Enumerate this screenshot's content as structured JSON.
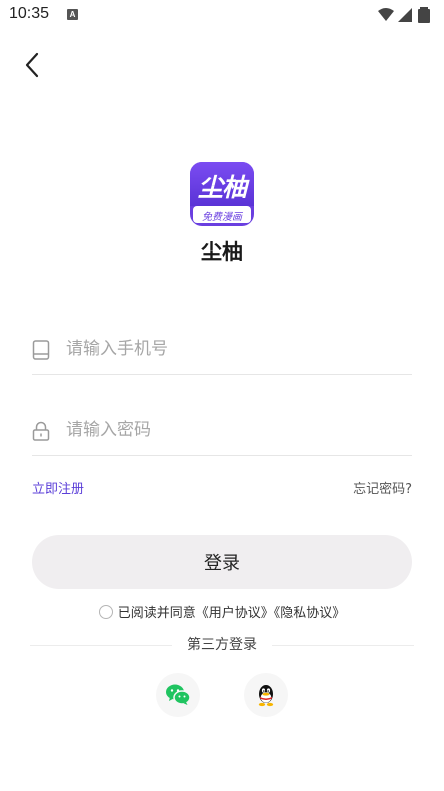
{
  "status_bar": {
    "time": "10:35",
    "notification_icon": "A"
  },
  "header": {
    "back_icon": "chevron-left-icon"
  },
  "app": {
    "logo_text": "尘柚",
    "logo_subtext": "免费漫画",
    "name": "尘柚",
    "accent_color": "#6a3fe0"
  },
  "form": {
    "phone_placeholder": "请输入手机号",
    "phone_value": "",
    "password_placeholder": "请输入密码",
    "password_value": "",
    "register_label": "立即注册",
    "forgot_label": "忘记密码?",
    "login_label": "登录"
  },
  "agreement": {
    "checked": false,
    "prefix": "已阅读并同意",
    "user_agreement": "《用户协议》",
    "privacy_agreement": "《隐私协议》"
  },
  "third_party": {
    "label": "第三方登录",
    "providers": [
      "wechat-icon",
      "qq-icon"
    ]
  }
}
